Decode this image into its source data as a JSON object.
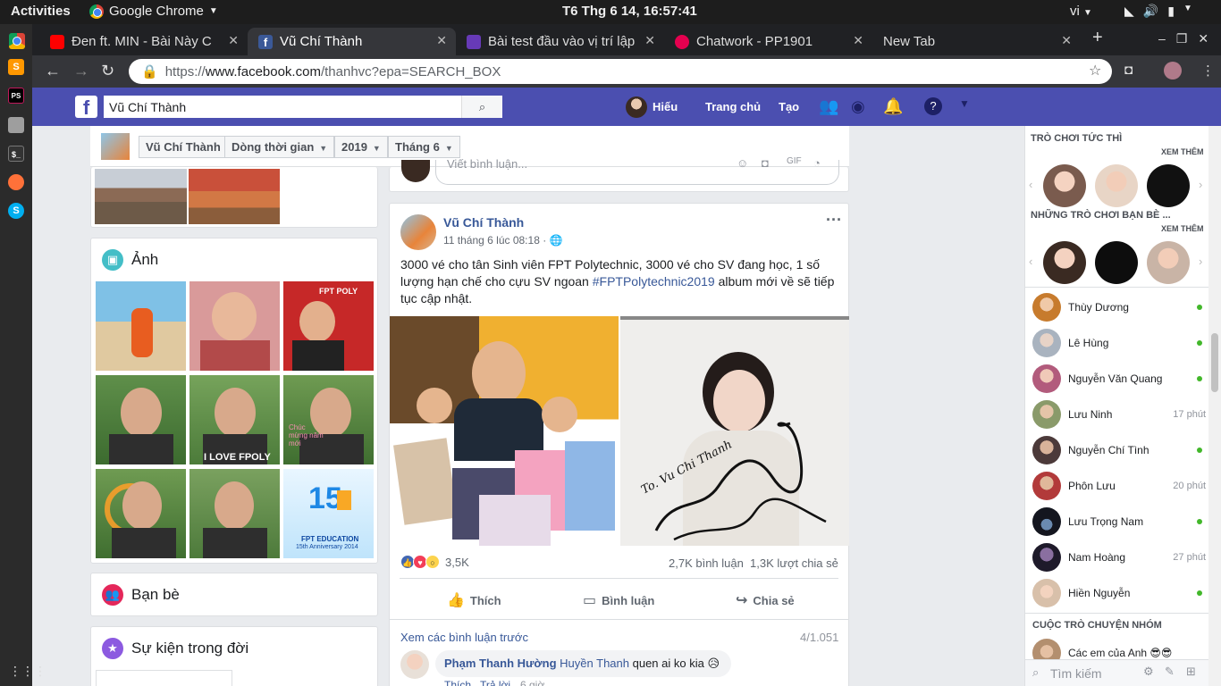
{
  "system": {
    "activities": "Activities",
    "app_name": "Google Chrome",
    "clock": "T6 Thg 6 14, 16:57:41",
    "lang": "vi"
  },
  "tabs": [
    {
      "title": "Đen ft. MIN - Bài Này C",
      "favicon": "youtube-icon",
      "color": "#ff0000"
    },
    {
      "title": "Vũ Chí Thành",
      "favicon": "facebook-icon",
      "color": "#3b5998"
    },
    {
      "title": "Bài test đầu vào vị trí lập",
      "favicon": "forms-icon",
      "color": "#673ab7"
    },
    {
      "title": "Chatwork - PP1901",
      "favicon": "chatwork-icon",
      "color": "#e5004f"
    },
    {
      "title": "New Tab",
      "favicon": "",
      "color": ""
    }
  ],
  "address": {
    "scheme": "https://",
    "host": "www.facebook.com",
    "path": "/thanhvc?epa=SEARCH_BOX"
  },
  "fb": {
    "search_value": "Vũ Chí Thành",
    "user": "Hiếu",
    "home": "Trang chủ",
    "create": "Tạo",
    "brand_color": "#4b4fb0"
  },
  "breadcrumbs": [
    "Vũ Chí Thành",
    "Dòng thời gian",
    "2019",
    "Tháng 6"
  ],
  "left": {
    "photos_title": "Ảnh",
    "friends_title": "Bạn bè",
    "life_events_title": "Sự kiện trong đời"
  },
  "post_prev": {
    "comment_placeholder": "Viết bình luận..."
  },
  "post": {
    "author": "Vũ Chí Thành",
    "time": "11 tháng 6 lúc 08:18 · ",
    "text_before": "3000 vé cho tân Sinh viên FPT Polytechnic, 3000 vé cho SV đang học, 1 số lượng hạn chế cho cựu SV ngoan ",
    "hashtag": "#FPTPolytechnic2019",
    "text_after": " album mới về sẽ tiếp tục cập nhật.",
    "reaction_count": "3,5K",
    "comment_count": "2,7K bình luận",
    "share_count": "1,3K lượt chia sẻ",
    "like_label": "Thích",
    "comment_label": "Bình luận",
    "share_label": "Chia sẻ",
    "prev_comments": "Xem các bình luận trước",
    "comment_pager": "4/1.051",
    "comment": {
      "author": "Phạm Thanh Hường",
      "mention": "Huyền Thanh",
      "text": " quen ai ko kia 😥",
      "like": "Thích",
      "reply": "Trả lời",
      "ago": "6 giờ"
    },
    "signature": "To. Vu Chi Thanh"
  },
  "chat": {
    "games_title": "TRÒ CHƠI TỨC THÌ",
    "friends_games_title": "NHỮNG TRÒ CHƠI BẠN BÈ ...",
    "see_more": "XEM THÊM",
    "group_title": "CUỘC TRÒ CHUYỆN NHÓM",
    "group_name": "Các em của Anh 😎😎",
    "search_placeholder": "Tìm kiếm",
    "contacts": [
      {
        "name": "Thùy Dương",
        "online": true,
        "ago": ""
      },
      {
        "name": "Lê Hùng",
        "online": true,
        "ago": ""
      },
      {
        "name": "Nguyễn Văn Quang",
        "online": true,
        "ago": ""
      },
      {
        "name": "Lưu Ninh",
        "online": false,
        "ago": "17 phút"
      },
      {
        "name": "Nguyễn Chí Tình",
        "online": true,
        "ago": ""
      },
      {
        "name": "Phôn Lưu",
        "online": false,
        "ago": "20 phút"
      },
      {
        "name": "Lưu Trọng Nam",
        "online": true,
        "ago": ""
      },
      {
        "name": "Nam Hoàng",
        "online": false,
        "ago": "27 phút"
      },
      {
        "name": "Hiền Nguyễn",
        "online": true,
        "ago": ""
      }
    ]
  },
  "photo_grid": {
    "fpt_logo": "FPT POLY",
    "badge_year": "15",
    "badge_text": "FPT EDUCATION",
    "badge_sub": "15th Anniversary 2014",
    "i_love": "I LOVE FPOLY",
    "chuc_mung": "Chúc mừng năm mới"
  }
}
